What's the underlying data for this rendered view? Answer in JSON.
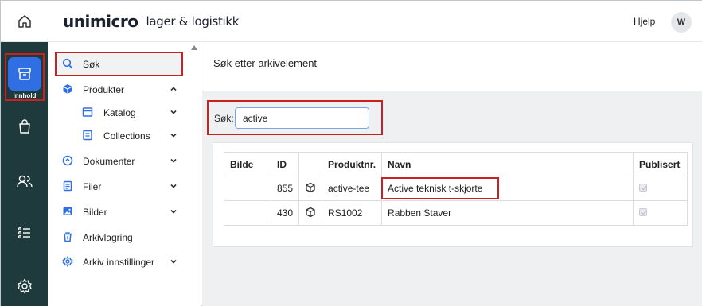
{
  "header": {
    "brand_name": "unimicro",
    "brand_sub": "lager & logistikk",
    "help_label": "Hjelp",
    "avatar_initial": "W"
  },
  "rail": {
    "active_label": "Innhold",
    "items": [
      {
        "icon": "archive-box-icon",
        "label": "Innhold",
        "active": true
      },
      {
        "icon": "shopping-bag-icon"
      },
      {
        "icon": "users-icon"
      },
      {
        "icon": "list-icon"
      },
      {
        "icon": "gear-icon"
      }
    ]
  },
  "subnav": {
    "items": [
      {
        "icon": "search-icon",
        "label": "Søk",
        "active": true
      },
      {
        "icon": "cube-icon",
        "label": "Produkter",
        "chevron": "up"
      },
      {
        "icon": "catalog-icon",
        "label": "Katalog",
        "chevron": "down",
        "child": true
      },
      {
        "icon": "collection-icon",
        "label": "Collections",
        "chevron": "down",
        "child": true
      },
      {
        "icon": "document-icon",
        "label": "Dokumenter",
        "chevron": "down"
      },
      {
        "icon": "files-icon",
        "label": "Filer",
        "chevron": "down"
      },
      {
        "icon": "image-icon",
        "label": "Bilder",
        "chevron": "down"
      },
      {
        "icon": "trash-icon",
        "label": "Arkivlagring"
      },
      {
        "icon": "settings-icon",
        "label": "Arkiv innstillinger",
        "chevron": "down"
      }
    ]
  },
  "main": {
    "title": "Søk etter arkivelement",
    "search": {
      "label": "Søk:",
      "value": "active",
      "placeholder": ""
    },
    "table": {
      "columns": [
        "Bilde",
        "ID",
        "",
        "Produktnr.",
        "Navn",
        "Publisert"
      ],
      "rows": [
        {
          "image": "",
          "id": "855",
          "type_icon": "cube-icon",
          "product_no": "active-tee",
          "name": "Active teknisk t-skjorte",
          "published": true
        },
        {
          "image": "",
          "id": "430",
          "type_icon": "cube-icon",
          "product_no": "RS1002",
          "name": "Rabben Staver",
          "published": true
        }
      ]
    }
  },
  "colors": {
    "rail_bg": "#1e3a3c",
    "accent": "#2f6fe3",
    "highlight_border": "#cc1f1f",
    "main_bg": "#eef0f2"
  }
}
